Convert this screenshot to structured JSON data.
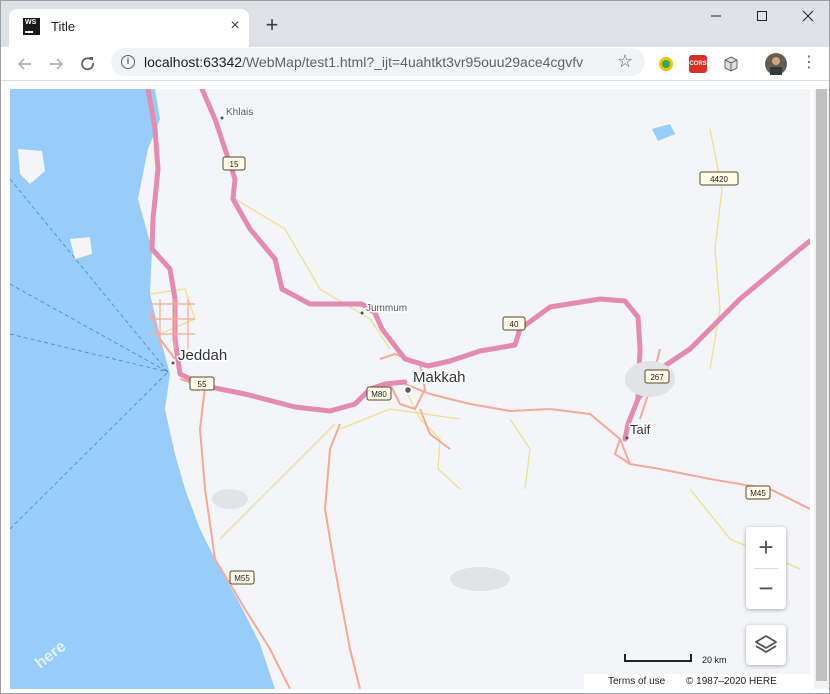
{
  "browser": {
    "tab_title": "Title",
    "tab_favicon_text": "WS",
    "url_host": "localhost:63342",
    "url_path": "/WebMap/test1.html?_ijt=4uahtkt3vr95ouu29ace4cgvfv",
    "ext_cors_label": "CORS"
  },
  "map": {
    "cities": {
      "jeddah": "Jeddah",
      "makkah": "Makkah",
      "taif": "Taif",
      "khlais": "Khlais",
      "jummum": "Jummum"
    },
    "road_shields": {
      "r15": "15",
      "r4420": "4420",
      "r40": "40",
      "r267": "267",
      "m80": "M80",
      "r55": "55",
      "m45": "M45",
      "m55": "M55"
    },
    "scale_label": "20 km",
    "terms": "Terms of use",
    "copyright": "© 1987–2020 HERE",
    "logo": "here",
    "zoom_in": "+",
    "zoom_out": "−",
    "colors": {
      "water": "#99cdf9",
      "land": "#f4f5f8",
      "motorway": "#e48bb2",
      "major_road": "#f7a999",
      "minor_road": "#efe08d"
    }
  }
}
